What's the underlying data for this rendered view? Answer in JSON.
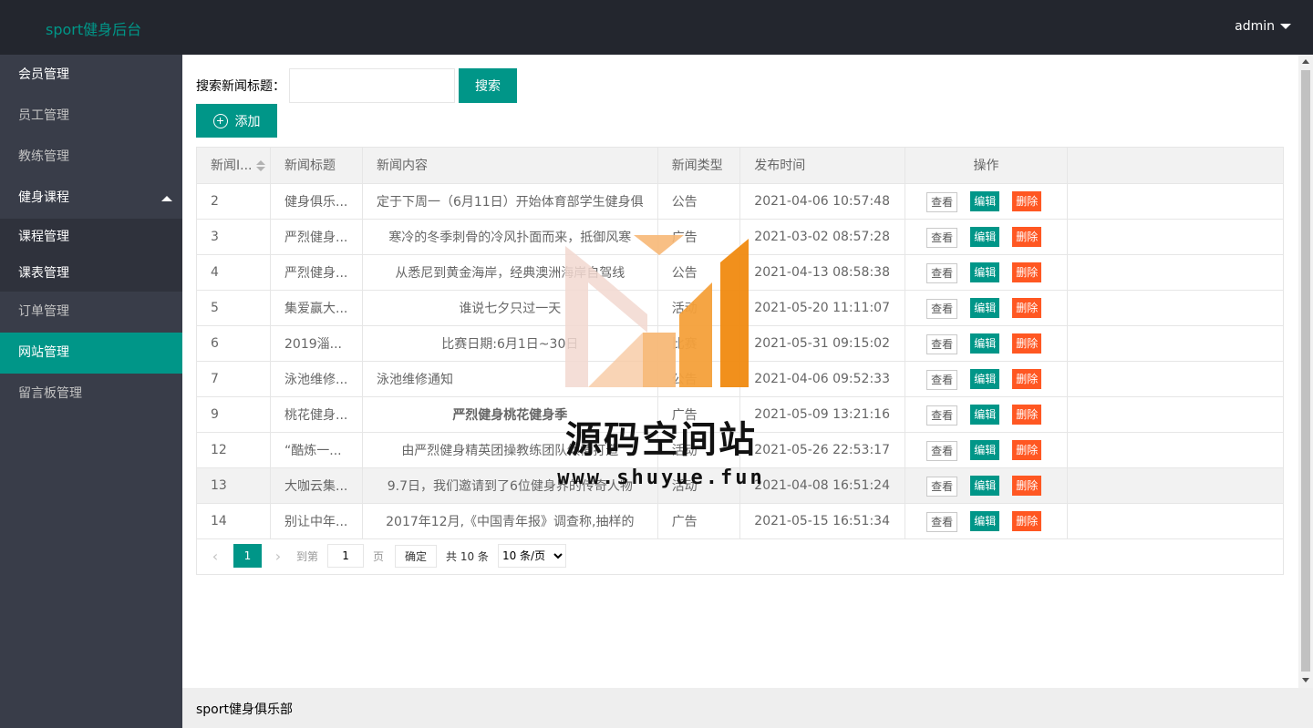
{
  "header": {
    "app_title": "sport健身后台",
    "user": "admin"
  },
  "sidebar": {
    "items": [
      {
        "label": "会员管理"
      },
      {
        "label": "员工管理"
      },
      {
        "label": "教练管理"
      },
      {
        "label": "健身课程"
      },
      {
        "label": "订单管理"
      },
      {
        "label": "网站管理"
      },
      {
        "label": "留言板管理"
      }
    ],
    "sub_items": [
      {
        "label": "课程管理"
      },
      {
        "label": "课表管理"
      }
    ]
  },
  "search": {
    "label": "搜索新闻标题：",
    "value": "",
    "button": "搜索"
  },
  "add_button": "添加",
  "table": {
    "headers": [
      "新闻I...",
      "新闻标题",
      "新闻内容",
      "新闻类型",
      "发布时间",
      "操作"
    ],
    "ops": {
      "view": "查看",
      "edit": "编辑",
      "delete": "删除"
    },
    "rows": [
      {
        "id": "2",
        "title": "健身俱乐...",
        "content": "定于下周一（6月11日）开始体育部学生健身俱",
        "type": "公告",
        "time": "2021-04-06 10:57:48"
      },
      {
        "id": "3",
        "title": "严烈健身...",
        "content": "寒冷的冬季刺骨的冷风扑面而来，抵御风寒",
        "type": "广告",
        "time": "2021-03-02 08:57:28"
      },
      {
        "id": "4",
        "title": "严烈健身...",
        "content": "从悉尼到黄金海岸，经典澳洲海岸自驾线",
        "type": "公告",
        "time": "2021-04-13 08:58:38"
      },
      {
        "id": "5",
        "title": "集爱赢大...",
        "content": "谁说七夕只过一天",
        "type": "活动",
        "time": "2021-05-20 11:11:07"
      },
      {
        "id": "6",
        "title": "2019淄...",
        "content": "比赛日期:6月1日~30日",
        "type": "比赛",
        "time": "2021-05-31 09:15:02"
      },
      {
        "id": "7",
        "title": "泳池维修...",
        "content": "泳池维修通知",
        "type": "公告",
        "time": "2021-04-06 09:52:33"
      },
      {
        "id": "9",
        "title": "桃花健身...",
        "content": "严烈健身桃花健身季",
        "type": "广告",
        "time": "2021-05-09 13:21:16"
      },
      {
        "id": "12",
        "title": "“酷炼一...",
        "content": "由严烈健身精英团操教练团队倾情打造",
        "type": "活动",
        "time": "2021-05-26 22:53:17"
      },
      {
        "id": "13",
        "title": "大咖云集...",
        "content": "9.7日，我们邀请到了6位健身界的传奇人物",
        "type": "活动",
        "time": "2021-04-08 16:51:24"
      },
      {
        "id": "14",
        "title": "别让中年...",
        "content": "2017年12月,《中国青年报》调查称,抽样的",
        "type": "广告",
        "time": "2021-05-15 16:51:34"
      }
    ]
  },
  "pager": {
    "current": "1",
    "goto_label": "到第",
    "goto_value": "1",
    "page_unit": "页",
    "ok": "确定",
    "total": "共 10 条",
    "size": "10 条/页"
  },
  "footer": {
    "text": "sport健身俱乐部"
  },
  "watermark": {
    "title": "源码空间站",
    "url": "www.shuyue.fun"
  }
}
